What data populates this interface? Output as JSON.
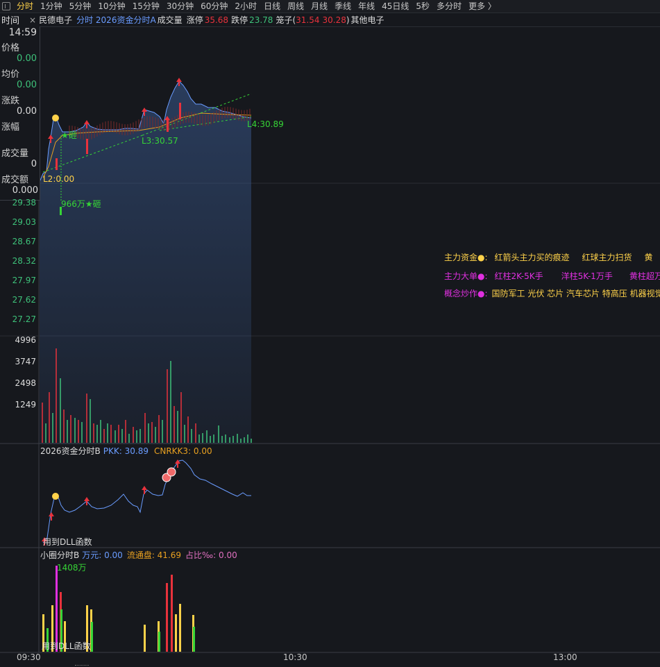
{
  "tabs": [
    "分时",
    "1分钟",
    "5分钟",
    "10分钟",
    "15分钟",
    "30分钟",
    "60分钟",
    "2小时",
    "日线",
    "周线",
    "月线",
    "季线",
    "年线",
    "45日线",
    "5秒",
    "多分时",
    "更多 〉"
  ],
  "info": {
    "time_label": "时间",
    "close": "×",
    "stock": "民德电子",
    "formula": "分时 2026资金分时A",
    "vol": "成交量",
    "zt_label": "涨停",
    "zt": "35.68",
    "dt_label": "跌停",
    "dt": "23.78",
    "cage_label": "笼子(",
    "cage_a": "31.54",
    "cage_b": "30.28",
    ")": ")",
    "sector": "其他电子"
  },
  "panel": {
    "time": "14:59",
    "price_label": "价格",
    "price": "0.00",
    "avg_label": "均价",
    "avg": "0.00",
    "chg_label": "涨跌",
    "chg": "0.00",
    "pct_label": "涨幅",
    "vol_label": "成交量",
    "vol": "0",
    "amt_label": "成交额",
    "amt": "0.000"
  },
  "price_axis": [
    "29.38",
    "29.03",
    "28.67",
    "28.32",
    "27.97",
    "27.62",
    "27.27"
  ],
  "vol_axis": [
    "4996",
    "3747",
    "2498",
    "1249"
  ],
  "annotations": {
    "l2": "L2:0.00",
    "l3": "L3:30.57",
    "l4": "L4:30.89",
    "star1": "★砸",
    "star2": "966万★砸",
    "dll1": "用到DLL函数",
    "dll2": "用到DLL函数",
    "big": "1408万"
  },
  "legend": {
    "row1": [
      "主力资金●:",
      "红箭头主力买的痕迹",
      "红球主力扫货",
      "黄"
    ],
    "row2": [
      "主力大单●:",
      "红柱2K-5K手",
      "洋柱5K-1万手",
      "黄柱超万"
    ],
    "row3": [
      "概念炒作●:",
      "国防军工 光伏 芯片 汽车芯片 特高压 机器视觉"
    ]
  },
  "subB": {
    "title": "2026资金分时B",
    "pkk": "PKK: 30.89",
    "cnr": "CNRKK3: 0.00"
  },
  "subC": {
    "title": "小圈分时B",
    "wy": "万元: 0.00",
    "ltp": "流通盘: 41.69",
    "zb": "占比‰: 0.00"
  },
  "time_axis": [
    "09:30",
    "10:30",
    "13:00"
  ],
  "colors": {
    "up": "#e8323c",
    "down": "#3ec27a",
    "line": "#6a9cff",
    "avg": "#e8a020",
    "yellow": "#ffd24a",
    "green": "#36d436",
    "magenta": "#e030e0"
  }
}
